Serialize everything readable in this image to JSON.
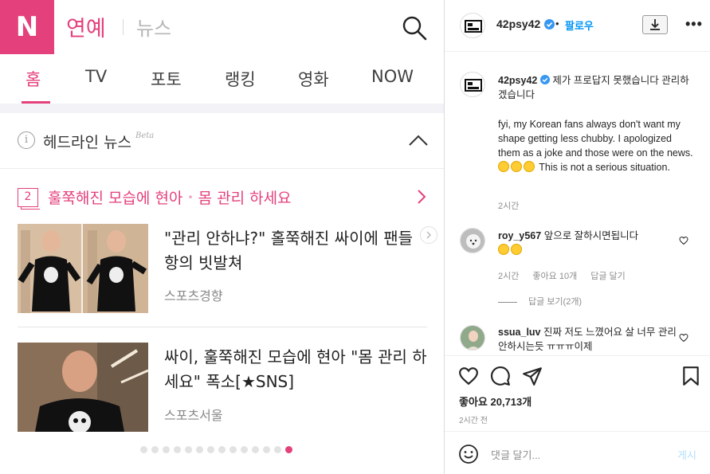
{
  "naver": {
    "logo": "N",
    "section": "연예",
    "subsection": "뉴스",
    "tabs": [
      "홈",
      "TV",
      "포토",
      "랭킹",
      "영화",
      "NOW"
    ],
    "active_tab": "홈",
    "headline_title": "헤드라인 뉴스",
    "headline_badge": "Beta",
    "topic": {
      "number": "2",
      "text_part1": "훌쭉해진 모습에 현아",
      "separator": "•",
      "text_part2": "몸 관리 하세요"
    },
    "news": [
      {
        "title": "\"관리 안하냐?\" 홀쭉해진 싸이에 팬들 항의 빗발쳐",
        "source": "스포츠경향"
      },
      {
        "title": "싸이, 훌쭉해진 모습에 현아 \"몸 관리 하세요\" 폭소[★SNS]",
        "source": "스포츠서울"
      }
    ],
    "pagination": {
      "total": 14,
      "active": 14
    },
    "colors": {
      "brand": "#e4407b"
    }
  },
  "instagram": {
    "username": "42psy42",
    "follow_separator": "•",
    "follow_label": "팔로우",
    "caption": {
      "username": "42psy42",
      "text_ko": "제가 프로답지 못했습니다 관리하겠습니다",
      "text_en": "fyi, my Korean fans always don't want my shape getting less chubby. I apologized them as a joke and those were on the news.",
      "text_en_tail": "This is not a serious situation.",
      "time": "2시간"
    },
    "comments": [
      {
        "username": "roy_y567",
        "text": "앞으로 잘하시면됩니다",
        "time": "2시간",
        "likes": "좋아요 10개",
        "reply_label": "답글 달기",
        "view_replies": "답글 보기(2개)"
      },
      {
        "username": "ssua_luv",
        "text": "진짜 저도 느꼈어요 살 너무 관리 안하시는듯 ㅠㅠㅠ이제"
      }
    ],
    "likes": "좋아요 20,713개",
    "posted": "2시간 전",
    "add_comment_placeholder": "댓글 달기...",
    "post_button": "게시",
    "colors": {
      "link": "#0095f6",
      "post_disabled": "#b2dffc"
    }
  }
}
